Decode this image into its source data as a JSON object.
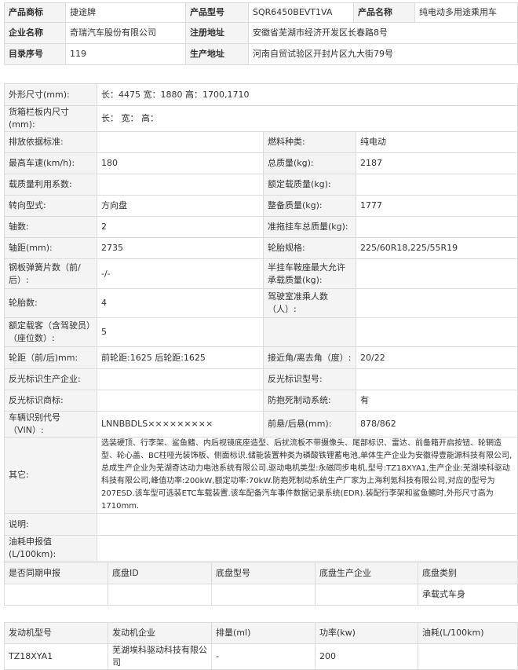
{
  "basic": {
    "rows": [
      [
        {
          "label": "产品商标",
          "value": "捷途牌"
        },
        {
          "label": "产品型号",
          "value": "SQR6450BEVT1VA"
        },
        {
          "label": "产品名称",
          "value": "纯电动多用途乘用车"
        }
      ],
      [
        {
          "label": "企业名称",
          "value": "奇瑞汽车股份有限公司"
        },
        {
          "label": "注册地址",
          "value": "安徽省芜湖市经济开发区长春路8号"
        }
      ],
      [
        {
          "label": "目录序号",
          "value": "119"
        },
        {
          "label": "生产地址",
          "value": "河南自贸试验区开封片区九大街79号"
        }
      ]
    ]
  },
  "specs": {
    "dimensions_label": "外形尺寸(mm):",
    "dimensions_value": "长：4475 宽：1880 高：1700,1710",
    "cargo_label": "货箱栏板内尺寸(mm):",
    "cargo_value": "长：  宽：  高：",
    "pairs": [
      {
        "l1": "排放依据标准:",
        "v1": "",
        "l2": "燃料种类:",
        "v2": "纯电动"
      },
      {
        "l1": "最高车速(km/h):",
        "v1": "180",
        "l2": "总质量(kg):",
        "v2": "2187"
      },
      {
        "l1": "载质量利用系数:",
        "v1": "",
        "l2": "额定载质量(kg):",
        "v2": ""
      },
      {
        "l1": "转向型式:",
        "v1": "方向盘",
        "l2": "整备质量(kg):",
        "v2": "1777"
      },
      {
        "l1": "轴数:",
        "v1": "2",
        "l2": "准拖挂车总质量(kg):",
        "v2": ""
      },
      {
        "l1": "轴距(mm):",
        "v1": "2735",
        "l2": "轮胎规格:",
        "v2": "225/60R18,225/55R19"
      },
      {
        "l1": "钢板弹簧片数（前/后）:",
        "v1": "-/-",
        "l2": "半挂车鞍座最大允许承载质量(kg):",
        "v2": ""
      },
      {
        "l1": "轮胎数:",
        "v1": "4",
        "l2": "驾驶室准乘人数（人）:",
        "v2": ""
      },
      {
        "l1": "额定载客（含驾驶员）（座位数）:",
        "v1": "5",
        "l2": "",
        "v2": ""
      },
      {
        "l1": "轮距（前/后)mm:",
        "v1": "前轮距:1625 后轮距:1625",
        "l2": "接近角/离去角（度）:",
        "v2": "20/22"
      },
      {
        "l1": "反光标识生产企业:",
        "v1": "",
        "l2": "反光标识型号:",
        "v2": ""
      },
      {
        "l1": "反光标识商标:",
        "v1": "",
        "l2": "防抱死制动系统:",
        "v2": "有"
      },
      {
        "l1": "车辆识别代号（VIN）:",
        "v1": "LNNBBDLS×××××××××",
        "l2": "前悬/后悬(mm):",
        "v2": "878/862"
      }
    ],
    "other_label": "其它:",
    "other_value": "选装硬顶、行李架、鲨鱼鳍、内后视镜底座造型、后扰流板不带摄像头、尾部标识、雷达、前备箱开启按钮、轮辋造型、轮心盖、BC柱哑光装饰板、侧面标识.储能装置种类为磷酸铁锂蓄电池,单体生产企业为安徽得壹能源科技有限公司,总成生产企业为芜湖奇达动力电池系统有限公司.驱动电机类型:永磁同步电机,型号:TZ18XYA1,生产企业:芜湖埃科驱动科技有限公司,峰值功率:200kW,额定功率:70kW.防抱死制动系统生产厂家为上海利氪科技有限公司,对应的型号为207ESD.该车型可选装ETC车载装置.该车配备汽车事件数据记录系统(EDR).装配行李架和鲨鱼鳍时,外形尺寸高为1710mm.",
    "note_label": "说明:",
    "note_value": "",
    "fuel_label": "油耗申报值(L/100km):",
    "fuel_value": ""
  },
  "chassis": {
    "headers": [
      "是否同期申报",
      "底盘ID",
      "底盘型号",
      "底盘生产企业",
      "底盘类别"
    ],
    "row": [
      "",
      "",
      "",
      "",
      "承载式车身"
    ]
  },
  "engine": {
    "headers": [
      "发动机型号",
      "发动机企业",
      "排量(ml)",
      "功率(kw)",
      "油耗(L/100km)"
    ],
    "row": [
      "TZ18XYA1",
      "芜湖埃科驱动科技有限公司",
      "-",
      "200",
      ""
    ]
  }
}
